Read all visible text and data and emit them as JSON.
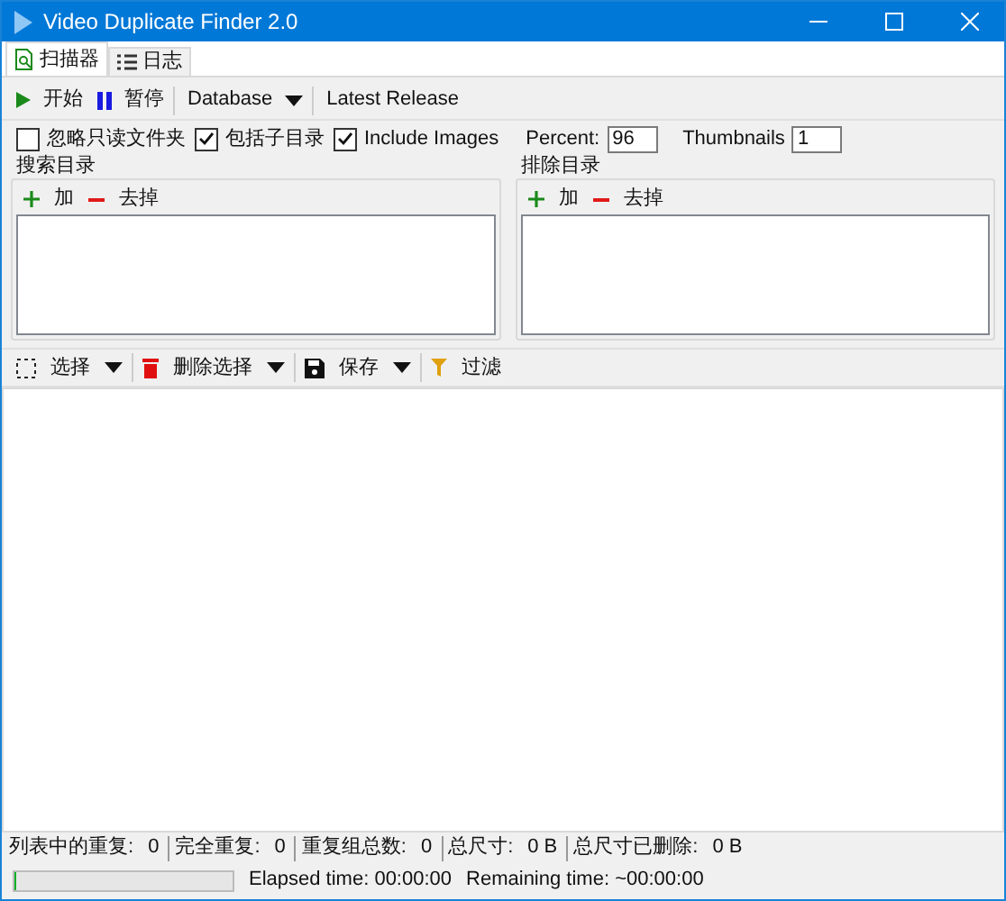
{
  "window": {
    "title": "Video Duplicate Finder 2.0"
  },
  "tabs": [
    {
      "label": "扫描器",
      "kind": "scan",
      "selected": true
    },
    {
      "label": "日志",
      "kind": "list",
      "selected": false
    }
  ],
  "toolbar": [
    {
      "kind": "play",
      "label": "开始",
      "dropdown": false
    },
    {
      "kind": "pause",
      "label": "暂停",
      "dropdown": false
    },
    {
      "kind": "menu",
      "label": "Database",
      "dropdown": true
    },
    {
      "kind": "link",
      "label": "Latest Release",
      "dropdown": false
    }
  ],
  "options": {
    "checkboxes": [
      {
        "label": "忽略只读文件夹",
        "checked": false
      },
      {
        "label": "包括子目录",
        "checked": true
      },
      {
        "label": "Include Images",
        "checked": true
      }
    ],
    "percent": {
      "label": "Percent:",
      "value": "96"
    },
    "thumbnails": {
      "label": "Thumbnails",
      "value": "1"
    }
  },
  "folders": [
    {
      "title": "搜索目录",
      "actions": [
        {
          "kind": "plus",
          "label": "加"
        },
        {
          "kind": "minus",
          "label": "去掉"
        }
      ]
    },
    {
      "title": "排除目录",
      "actions": [
        {
          "kind": "plus",
          "label": "加"
        },
        {
          "kind": "minus",
          "label": "去掉"
        }
      ]
    }
  ],
  "results_toolbar": [
    {
      "kind": "select",
      "label": "选择",
      "dropdown": true
    },
    {
      "kind": "trash",
      "label": "删除选择",
      "dropdown": true
    },
    {
      "kind": "save",
      "label": "保存",
      "dropdown": true
    },
    {
      "kind": "filter",
      "label": "过滤",
      "dropdown": false
    }
  ],
  "status_bar": {
    "stats": [
      {
        "label": "列表中的重复:",
        "value": "0"
      },
      {
        "label": "完全重复:",
        "value": "0"
      },
      {
        "label": "重复组总数:",
        "value": "0"
      },
      {
        "label": "总尺寸:",
        "value": "0 B"
      },
      {
        "label": "总尺寸已删除:",
        "value": "0 B"
      }
    ],
    "progress": {
      "level": 0
    },
    "elapsed": "Elapsed time: 00:00:00",
    "remaining": "Remaining time: ~00:00:00"
  }
}
